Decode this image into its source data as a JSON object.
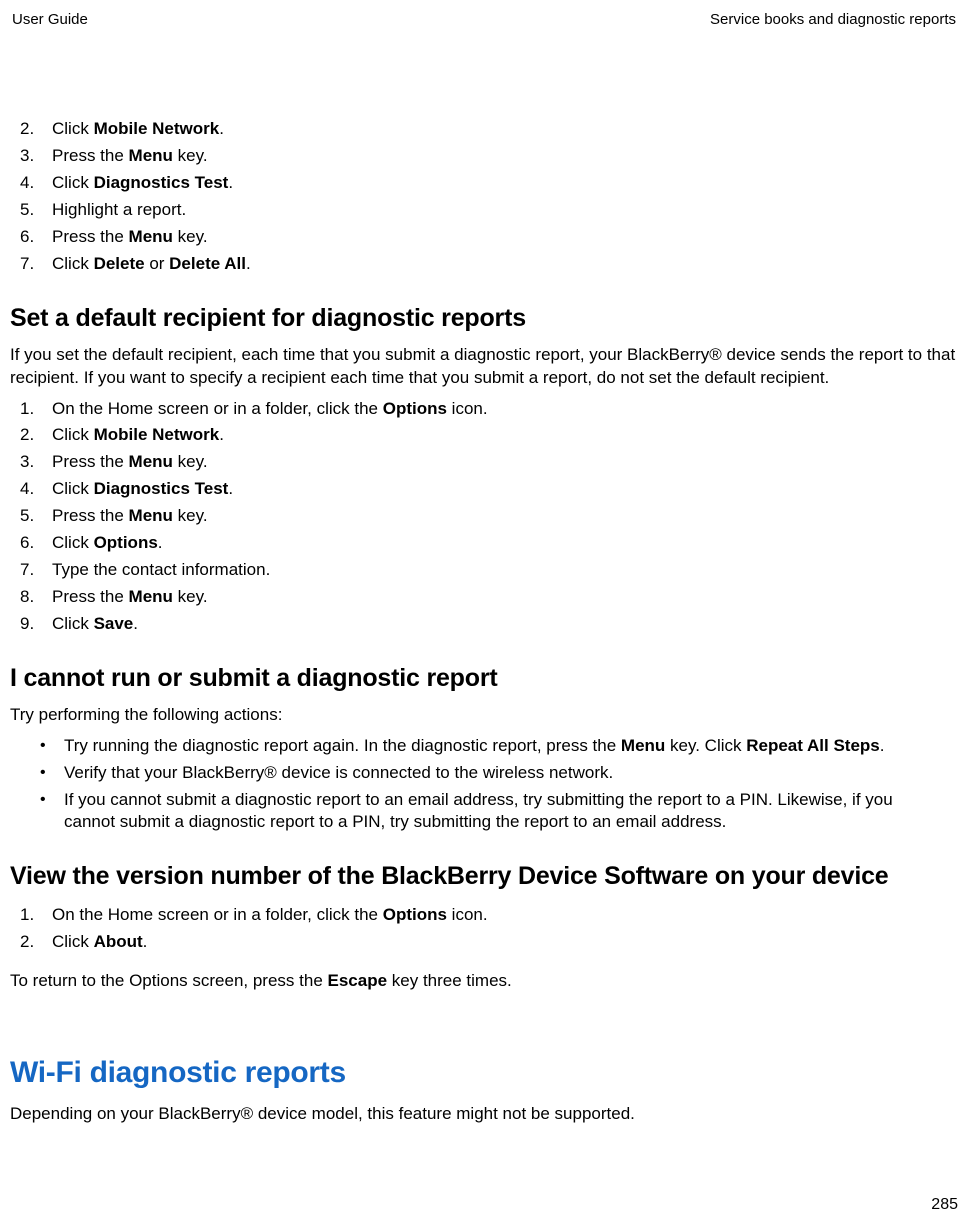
{
  "header": {
    "left": "User Guide",
    "right": "Service books and diagnostic reports"
  },
  "listA": {
    "items": [
      {
        "n": "2.",
        "pre": "Click ",
        "b1": "Mobile Network",
        "post": "."
      },
      {
        "n": "3.",
        "pre": "Press the ",
        "b1": "Menu",
        "post": " key."
      },
      {
        "n": "4.",
        "pre": "Click ",
        "b1": "Diagnostics Test",
        "post": "."
      },
      {
        "n": "5.",
        "pre": "Highlight a report.",
        "b1": "",
        "post": ""
      },
      {
        "n": "6.",
        "pre": "Press the ",
        "b1": "Menu",
        "post": " key."
      },
      {
        "n": "7.",
        "pre": "Click ",
        "b1": "Delete",
        "mid": " or ",
        "b2": "Delete All",
        "post": "."
      }
    ]
  },
  "sectionB": {
    "title": "Set a default recipient for diagnostic reports",
    "intro": "If you set the default recipient, each time that you submit a diagnostic report, your BlackBerry® device sends the report to that recipient. If you want to specify a recipient each time that you submit a report, do not set the default recipient.",
    "items": [
      {
        "n": "1.",
        "pre": "On the Home screen or in a folder, click the ",
        "b1": "Options",
        "post": " icon."
      },
      {
        "n": "2.",
        "pre": "Click ",
        "b1": "Mobile Network",
        "post": "."
      },
      {
        "n": "3.",
        "pre": "Press the ",
        "b1": "Menu",
        "post": " key."
      },
      {
        "n": "4.",
        "pre": "Click ",
        "b1": "Diagnostics Test",
        "post": "."
      },
      {
        "n": "5.",
        "pre": "Press the ",
        "b1": "Menu",
        "post": " key."
      },
      {
        "n": "6.",
        "pre": "Click ",
        "b1": "Options",
        "post": "."
      },
      {
        "n": "7.",
        "pre": "Type the contact information.",
        "b1": "",
        "post": ""
      },
      {
        "n": "8.",
        "pre": "Press the ",
        "b1": "Menu",
        "post": " key."
      },
      {
        "n": "9.",
        "pre": "Click ",
        "b1": "Save",
        "post": "."
      }
    ]
  },
  "sectionC": {
    "title": "I cannot run or submit a diagnostic report",
    "intro": "Try performing the following actions:",
    "bullets": [
      {
        "pre": "Try running the diagnostic report again. In the diagnostic report, press the ",
        "b1": "Menu",
        "mid": " key. Click ",
        "b2": "Repeat All Steps",
        "post": "."
      },
      {
        "pre": "Verify that your BlackBerry® device is connected to the wireless network.",
        "b1": "",
        "mid": "",
        "b2": "",
        "post": ""
      },
      {
        "pre": "If you cannot submit a diagnostic report to an email address, try submitting the report to a PIN. Likewise, if you cannot submit a diagnostic report to a PIN, try submitting the report to an email address.",
        "b1": "",
        "mid": "",
        "b2": "",
        "post": ""
      }
    ]
  },
  "sectionD": {
    "title": "View the version number of the BlackBerry Device Software on your device",
    "items": [
      {
        "n": "1.",
        "pre": "On the Home screen or in a folder, click the ",
        "b1": "Options",
        "post": " icon."
      },
      {
        "n": "2.",
        "pre": "Click ",
        "b1": "About",
        "post": "."
      }
    ],
    "outro_pre": "To return to the Options screen, press the ",
    "outro_b": "Escape",
    "outro_post": " key three times."
  },
  "sectionE": {
    "title": "Wi-Fi diagnostic reports",
    "para": "Depending on your BlackBerry® device model, this feature might not be supported."
  },
  "page_number": "285"
}
